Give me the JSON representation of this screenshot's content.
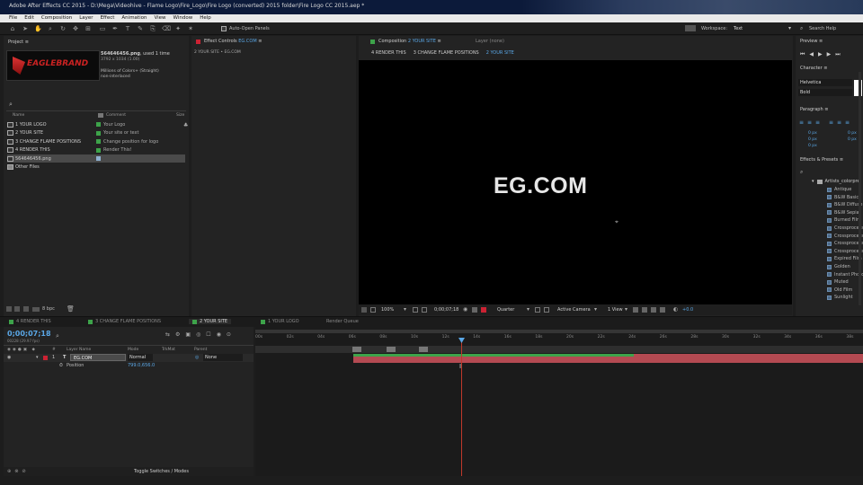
{
  "window": {
    "title": "Adobe After Effects CC 2015 - D:\\Mega\\Videohive - Flame Logo\\Fire_Logo\\Fire Logo (converted) 2015 folder\\Fire Logo CC 2015.aep *"
  },
  "menu": [
    "File",
    "Edit",
    "Composition",
    "Layer",
    "Effect",
    "Animation",
    "View",
    "Window",
    "Help"
  ],
  "toolbar": {
    "auto_open_panels": "Auto-Open Panels",
    "workspace_label": "Workspace:",
    "workspace_value": "Text",
    "search_help": "Search Help"
  },
  "project": {
    "tab": "Project",
    "thumb_text": "EAGLEBRAND",
    "file_name": "564646456.png",
    "used": ", used 1 time",
    "dims": "3792 x 1034 (1.00)",
    "colors": "Millions of Colors+ (Straight)",
    "interlace": "non-interlaced",
    "col_name": "Name",
    "col_comment": "Comment",
    "col_size": "Size",
    "items": [
      {
        "name": "1 YOUR LOGO",
        "comment": "Your Logo"
      },
      {
        "name": "2 YOUR SITE",
        "comment": "Your site or text"
      },
      {
        "name": "3 CHANGE FLAME POSITIONS",
        "comment": "Change position for logo"
      },
      {
        "name": "4 RENDER THIS",
        "comment": "Render This!"
      },
      {
        "name": "564646456.png",
        "comment": ""
      },
      {
        "name": "Other Files",
        "comment": ""
      }
    ],
    "bpc": "8 bpc"
  },
  "effect_controls": {
    "tab_prefix": "Effect Controls",
    "tab_layer": "EG.COM",
    "breadcrumb": "2 YOUR SITE • EG.COM"
  },
  "composition": {
    "tab_prefix": "Composition",
    "tab_name": "2 YOUR SITE",
    "layer_tab": "Layer (none)",
    "crumbs": [
      "4 RENDER THIS",
      "3 CHANGE FLAME POSITIONS",
      "2 YOUR SITE"
    ],
    "canvas_text": "EG.COM",
    "zoom": "100%",
    "timecode": "0;00;07;18",
    "quality": "Quarter",
    "camera": "Active Camera",
    "view": "1 View",
    "exposure": "+0.0"
  },
  "right_panel": {
    "preview": "Preview",
    "character": "Character",
    "font": "Helvetica",
    "style": "Bold",
    "paragraph": "Paragraph",
    "px_values": [
      "0 px",
      "0 px",
      "0 px",
      "0 px",
      "0 px"
    ],
    "effects_presets": "Effects & Presets",
    "folder": "Artists_colorpre",
    "presets": [
      "Antique",
      "B&W Basic",
      "B&W Diffuse",
      "B&W Sepia",
      "Burned Film",
      "Crossprocess",
      "Crossprocess",
      "Crossprocess",
      "Crossprocess",
      "Expired Film",
      "Golden",
      "Instant Photo",
      "Muted",
      "Old Film",
      "Sunlight"
    ]
  },
  "timeline": {
    "tabs": [
      "4 RENDER THIS",
      "3 CHANGE FLAME POSITIONS",
      "2 YOUR SITE",
      "1 YOUR LOGO",
      "Render Queue"
    ],
    "timecode": "0;00;07;18",
    "fps": "00228 (29.97 fps)",
    "col_num": "#",
    "col_layer": "Layer Name",
    "col_mode": "Mode",
    "col_trkmat": "TrkMat",
    "col_parent": "Parent",
    "layer_num": "1",
    "layer_name": "EG.COM",
    "layer_mode": "Normal",
    "parent": "None",
    "property": "Position",
    "position_value": "799.0,656.0",
    "ruler": [
      "00s",
      "02s",
      "04s",
      "06s",
      "08s",
      "10s",
      "12s",
      "14s",
      "16s",
      "18s",
      "20s",
      "22s",
      "24s",
      "26s",
      "28s",
      "30s",
      "32s",
      "34s",
      "36s",
      "38s"
    ],
    "toggle": "Toggle Switches / Modes"
  }
}
